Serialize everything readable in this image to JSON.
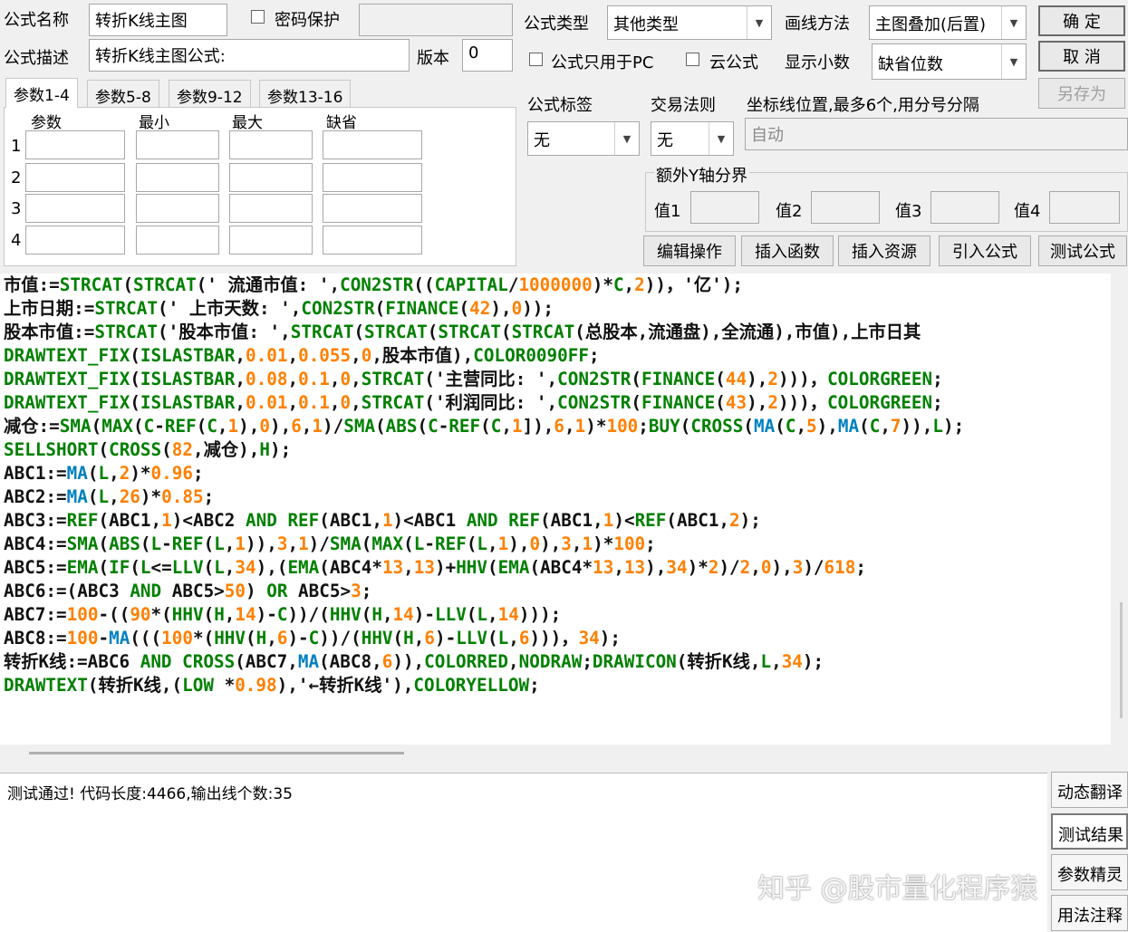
{
  "form": {
    "name_label": "公式名称",
    "name_value": "转折K线主图",
    "password_label": "密码保护",
    "desc_label": "公式描述",
    "desc_value": "转折K线主图公式:",
    "version_label": "版本",
    "version_value": "0",
    "type_label": "公式类型",
    "type_value": "其他类型",
    "draw_label": "画线方法",
    "draw_value": "主图叠加(后置)",
    "pc_only_label": "公式只用于PC",
    "cloud_label": "云公式",
    "decimal_label": "显示小数",
    "decimal_value": "缺省位数",
    "tag_label": "公式标签",
    "tag_value": "无",
    "trade_label": "交易法则",
    "trade_value": "无",
    "axis_label": "坐标线位置,最多6个,用分号分隔",
    "axis_value": "自动",
    "extra_y_label": "额外Y轴分界",
    "val1": "值1",
    "val2": "值2",
    "val3": "值3",
    "val4": "值4"
  },
  "buttons": {
    "ok": "确  定",
    "cancel": "取  消",
    "save_as": "另存为",
    "edit": "编辑操作",
    "insert_func": "插入函数",
    "insert_res": "插入资源",
    "import": "引入公式",
    "test": "测试公式"
  },
  "tabs": [
    "参数1-4",
    "参数5-8",
    "参数9-12",
    "参数13-16"
  ],
  "param_headers": [
    "参数",
    "最小",
    "最大",
    "缺省"
  ],
  "param_rows": [
    "1",
    "2",
    "3",
    "4"
  ],
  "output_text": "测试通过! 代码长度:4466,输出线个数:35",
  "side_buttons": [
    "动态翻译",
    "测试结果",
    "参数精灵",
    "用法注释"
  ],
  "watermark": "知乎 @股市量化程序猿",
  "code_lines": [
    [
      [
        "d",
        "市值:="
      ],
      [
        "k",
        "STRCAT"
      ],
      [
        "d",
        "("
      ],
      [
        "k",
        "STRCAT"
      ],
      [
        "d",
        "(' 流通市值: ',"
      ],
      [
        "k",
        "CON2STR"
      ],
      [
        "d",
        "(("
      ],
      [
        "k",
        "CAPITAL"
      ],
      [
        "d",
        "/"
      ],
      [
        "n",
        "1000000"
      ],
      [
        "d",
        ")*"
      ],
      [
        "k",
        "C"
      ],
      [
        "d",
        ","
      ],
      [
        "n",
        "2"
      ],
      [
        "d",
        "))，'亿');"
      ]
    ],
    [
      [
        "d",
        "上市日期:="
      ],
      [
        "k",
        "STRCAT"
      ],
      [
        "d",
        "(' 上市天数: ',"
      ],
      [
        "k",
        "CON2STR"
      ],
      [
        "d",
        "("
      ],
      [
        "k",
        "FINANCE"
      ],
      [
        "d",
        "("
      ],
      [
        "n",
        "42"
      ],
      [
        "d",
        "),"
      ],
      [
        "n",
        "0"
      ],
      [
        "d",
        "));"
      ]
    ],
    [
      [
        "d",
        "股本市值:="
      ],
      [
        "k",
        "STRCAT"
      ],
      [
        "d",
        "('股本市值: ',"
      ],
      [
        "k",
        "STRCAT"
      ],
      [
        "d",
        "("
      ],
      [
        "k",
        "STRCAT"
      ],
      [
        "d",
        "("
      ],
      [
        "k",
        "STRCAT"
      ],
      [
        "d",
        "("
      ],
      [
        "k",
        "STRCAT"
      ],
      [
        "d",
        "(总股本,流通盘),全流通),市值),上市日其"
      ]
    ],
    [
      [
        "k",
        "DRAWTEXT_FIX"
      ],
      [
        "d",
        "("
      ],
      [
        "k",
        "ISLASTBAR"
      ],
      [
        "d",
        ","
      ],
      [
        "n",
        "0.01"
      ],
      [
        "d",
        ","
      ],
      [
        "n",
        "0.055"
      ],
      [
        "d",
        ","
      ],
      [
        "n",
        "0"
      ],
      [
        "d",
        ",股本市值),"
      ],
      [
        "k",
        "COLOR0090FF"
      ],
      [
        "d",
        ";"
      ]
    ],
    [
      [
        "k",
        "DRAWTEXT_FIX"
      ],
      [
        "d",
        "("
      ],
      [
        "k",
        "ISLASTBAR"
      ],
      [
        "d",
        ","
      ],
      [
        "n",
        "0.08"
      ],
      [
        "d",
        ","
      ],
      [
        "n",
        "0.1"
      ],
      [
        "d",
        ","
      ],
      [
        "n",
        "0"
      ],
      [
        "d",
        ","
      ],
      [
        "k",
        "STRCAT"
      ],
      [
        "d",
        "('主营同比: ',"
      ],
      [
        "k",
        "CON2STR"
      ],
      [
        "d",
        "("
      ],
      [
        "k",
        "FINANCE"
      ],
      [
        "d",
        "("
      ],
      [
        "n",
        "44"
      ],
      [
        "d",
        "),"
      ],
      [
        "n",
        "2"
      ],
      [
        "d",
        ")))，"
      ],
      [
        "k",
        "COLORGREEN"
      ],
      [
        "d",
        ";"
      ]
    ],
    [
      [
        "k",
        "DRAWTEXT_FIX"
      ],
      [
        "d",
        "("
      ],
      [
        "k",
        "ISLASTBAR"
      ],
      [
        "d",
        ","
      ],
      [
        "n",
        "0.01"
      ],
      [
        "d",
        ","
      ],
      [
        "n",
        "0.1"
      ],
      [
        "d",
        ","
      ],
      [
        "n",
        "0"
      ],
      [
        "d",
        ","
      ],
      [
        "k",
        "STRCAT"
      ],
      [
        "d",
        "('利润同比: ',"
      ],
      [
        "k",
        "CON2STR"
      ],
      [
        "d",
        "("
      ],
      [
        "k",
        "FINANCE"
      ],
      [
        "d",
        "("
      ],
      [
        "n",
        "43"
      ],
      [
        "d",
        "),"
      ],
      [
        "n",
        "2"
      ],
      [
        "d",
        ")))，"
      ],
      [
        "k",
        "COLORGREEN"
      ],
      [
        "d",
        ";"
      ]
    ],
    [
      [
        "d",
        "减仓:="
      ],
      [
        "k",
        "SMA"
      ],
      [
        "d",
        "("
      ],
      [
        "k",
        "MAX"
      ],
      [
        "d",
        "("
      ],
      [
        "k",
        "C"
      ],
      [
        "d",
        "-"
      ],
      [
        "k",
        "REF"
      ],
      [
        "d",
        "("
      ],
      [
        "k",
        "C"
      ],
      [
        "d",
        ","
      ],
      [
        "n",
        "1"
      ],
      [
        "d",
        "),"
      ],
      [
        "n",
        "0"
      ],
      [
        "d",
        "),"
      ],
      [
        "n",
        "6"
      ],
      [
        "d",
        ","
      ],
      [
        "n",
        "1"
      ],
      [
        "d",
        ")/"
      ],
      [
        "k",
        "SMA"
      ],
      [
        "d",
        "("
      ],
      [
        "k",
        "ABS"
      ],
      [
        "d",
        "("
      ],
      [
        "k",
        "C"
      ],
      [
        "d",
        "-"
      ],
      [
        "k",
        "REF"
      ],
      [
        "d",
        "("
      ],
      [
        "k",
        "C"
      ],
      [
        "d",
        ","
      ],
      [
        "n",
        "1"
      ],
      [
        "d",
        "]),"
      ],
      [
        "n",
        "6"
      ],
      [
        "d",
        ","
      ],
      [
        "n",
        "1"
      ],
      [
        "d",
        ")*"
      ],
      [
        "n",
        "100"
      ],
      [
        "d",
        ";"
      ],
      [
        "k",
        "BUY"
      ],
      [
        "d",
        "("
      ],
      [
        "k",
        "CROSS"
      ],
      [
        "d",
        "("
      ],
      [
        "f",
        "MA"
      ],
      [
        "d",
        "("
      ],
      [
        "k",
        "C"
      ],
      [
        "d",
        ","
      ],
      [
        "n",
        "5"
      ],
      [
        "d",
        "),"
      ],
      [
        "f",
        "MA"
      ],
      [
        "d",
        "("
      ],
      [
        "k",
        "C"
      ],
      [
        "d",
        ","
      ],
      [
        "n",
        "7"
      ],
      [
        "d",
        ")),"
      ],
      [
        "k",
        "L"
      ],
      [
        "d",
        ");"
      ]
    ],
    [
      [
        "k",
        "SELLSHORT"
      ],
      [
        "d",
        "("
      ],
      [
        "k",
        "CROSS"
      ],
      [
        "d",
        "("
      ],
      [
        "n",
        "82"
      ],
      [
        "d",
        ",减仓),"
      ],
      [
        "k",
        "H"
      ],
      [
        "d",
        ");"
      ]
    ],
    [
      [
        "d",
        "ABC1:="
      ],
      [
        "f",
        "MA"
      ],
      [
        "d",
        "("
      ],
      [
        "k",
        "L"
      ],
      [
        "d",
        ","
      ],
      [
        "n",
        "2"
      ],
      [
        "d",
        ")*"
      ],
      [
        "n",
        "0.96"
      ],
      [
        "d",
        ";"
      ]
    ],
    [
      [
        "d",
        "ABC2:="
      ],
      [
        "f",
        "MA"
      ],
      [
        "d",
        "("
      ],
      [
        "k",
        "L"
      ],
      [
        "d",
        ","
      ],
      [
        "n",
        "26"
      ],
      [
        "d",
        ")*"
      ],
      [
        "n",
        "0.85"
      ],
      [
        "d",
        ";"
      ]
    ],
    [
      [
        "d",
        "ABC3:="
      ],
      [
        "k",
        "REF"
      ],
      [
        "d",
        "(ABC1,"
      ],
      [
        "n",
        "1"
      ],
      [
        "d",
        ")<ABC2 "
      ],
      [
        "k",
        "AND"
      ],
      [
        "d",
        " "
      ],
      [
        "k",
        "REF"
      ],
      [
        "d",
        "(ABC1,"
      ],
      [
        "n",
        "1"
      ],
      [
        "d",
        ")<ABC1 "
      ],
      [
        "k",
        "AND"
      ],
      [
        "d",
        " "
      ],
      [
        "k",
        "REF"
      ],
      [
        "d",
        "(ABC1,"
      ],
      [
        "n",
        "1"
      ],
      [
        "d",
        ")<"
      ],
      [
        "k",
        "REF"
      ],
      [
        "d",
        "(ABC1,"
      ],
      [
        "n",
        "2"
      ],
      [
        "d",
        ");"
      ]
    ],
    [
      [
        "d",
        "ABC4:="
      ],
      [
        "k",
        "SMA"
      ],
      [
        "d",
        "("
      ],
      [
        "k",
        "ABS"
      ],
      [
        "d",
        "("
      ],
      [
        "k",
        "L"
      ],
      [
        "d",
        "-"
      ],
      [
        "k",
        "REF"
      ],
      [
        "d",
        "("
      ],
      [
        "k",
        "L"
      ],
      [
        "d",
        ","
      ],
      [
        "n",
        "1"
      ],
      [
        "d",
        ")),"
      ],
      [
        "n",
        "3"
      ],
      [
        "d",
        ","
      ],
      [
        "n",
        "1"
      ],
      [
        "d",
        ")/"
      ],
      [
        "k",
        "SMA"
      ],
      [
        "d",
        "("
      ],
      [
        "k",
        "MAX"
      ],
      [
        "d",
        "("
      ],
      [
        "k",
        "L"
      ],
      [
        "d",
        "-"
      ],
      [
        "k",
        "REF"
      ],
      [
        "d",
        "("
      ],
      [
        "k",
        "L"
      ],
      [
        "d",
        ","
      ],
      [
        "n",
        "1"
      ],
      [
        "d",
        "),"
      ],
      [
        "n",
        "0"
      ],
      [
        "d",
        "),"
      ],
      [
        "n",
        "3"
      ],
      [
        "d",
        ","
      ],
      [
        "n",
        "1"
      ],
      [
        "d",
        ")*"
      ],
      [
        "n",
        "100"
      ],
      [
        "d",
        ";"
      ]
    ],
    [
      [
        "d",
        "ABC5:="
      ],
      [
        "k",
        "EMA"
      ],
      [
        "d",
        "("
      ],
      [
        "k",
        "IF"
      ],
      [
        "d",
        "("
      ],
      [
        "k",
        "L"
      ],
      [
        "d",
        "<="
      ],
      [
        "k",
        "LLV"
      ],
      [
        "d",
        "("
      ],
      [
        "k",
        "L"
      ],
      [
        "d",
        ","
      ],
      [
        "n",
        "34"
      ],
      [
        "d",
        "),("
      ],
      [
        "k",
        "EMA"
      ],
      [
        "d",
        "(ABC4*"
      ],
      [
        "n",
        "13"
      ],
      [
        "d",
        ","
      ],
      [
        "n",
        "13"
      ],
      [
        "d",
        ")+"
      ],
      [
        "k",
        "HHV"
      ],
      [
        "d",
        "("
      ],
      [
        "k",
        "EMA"
      ],
      [
        "d",
        "(ABC4*"
      ],
      [
        "n",
        "13"
      ],
      [
        "d",
        ","
      ],
      [
        "n",
        "13"
      ],
      [
        "d",
        "),"
      ],
      [
        "n",
        "34"
      ],
      [
        "d",
        ")*"
      ],
      [
        "n",
        "2"
      ],
      [
        "d",
        ")/"
      ],
      [
        "n",
        "2"
      ],
      [
        "d",
        ","
      ],
      [
        "n",
        "0"
      ],
      [
        "d",
        "),"
      ],
      [
        "n",
        "3"
      ],
      [
        "d",
        ")/"
      ],
      [
        "n",
        "618"
      ],
      [
        "d",
        ";"
      ]
    ],
    [
      [
        "d",
        "ABC6:=(ABC3 "
      ],
      [
        "k",
        "AND"
      ],
      [
        "d",
        " ABC5>"
      ],
      [
        "n",
        "50"
      ],
      [
        "d",
        ") "
      ],
      [
        "k",
        "OR"
      ],
      [
        "d",
        " ABC5>"
      ],
      [
        "n",
        "3"
      ],
      [
        "d",
        ";"
      ]
    ],
    [
      [
        "d",
        "ABC7:="
      ],
      [
        "n",
        "100"
      ],
      [
        "d",
        "-(("
      ],
      [
        "n",
        "90"
      ],
      [
        "d",
        "*("
      ],
      [
        "k",
        "HHV"
      ],
      [
        "d",
        "("
      ],
      [
        "k",
        "H"
      ],
      [
        "d",
        ","
      ],
      [
        "n",
        "14"
      ],
      [
        "d",
        ")-"
      ],
      [
        "k",
        "C"
      ],
      [
        "d",
        "))/("
      ],
      [
        "k",
        "HHV"
      ],
      [
        "d",
        "("
      ],
      [
        "k",
        "H"
      ],
      [
        "d",
        ","
      ],
      [
        "n",
        "14"
      ],
      [
        "d",
        ")-"
      ],
      [
        "k",
        "LLV"
      ],
      [
        "d",
        "("
      ],
      [
        "k",
        "L"
      ],
      [
        "d",
        ","
      ],
      [
        "n",
        "14"
      ],
      [
        "d",
        ")));"
      ]
    ],
    [
      [
        "d",
        "ABC8:="
      ],
      [
        "n",
        "100"
      ],
      [
        "d",
        "-"
      ],
      [
        "f",
        "MA"
      ],
      [
        "d",
        "((("
      ],
      [
        "n",
        "100"
      ],
      [
        "d",
        "*("
      ],
      [
        "k",
        "HHV"
      ],
      [
        "d",
        "("
      ],
      [
        "k",
        "H"
      ],
      [
        "d",
        ","
      ],
      [
        "n",
        "6"
      ],
      [
        "d",
        ")-"
      ],
      [
        "k",
        "C"
      ],
      [
        "d",
        "))/("
      ],
      [
        "k",
        "HHV"
      ],
      [
        "d",
        "("
      ],
      [
        "k",
        "H"
      ],
      [
        "d",
        ","
      ],
      [
        "n",
        "6"
      ],
      [
        "d",
        ")-"
      ],
      [
        "k",
        "LLV"
      ],
      [
        "d",
        "("
      ],
      [
        "k",
        "L"
      ],
      [
        "d",
        ","
      ],
      [
        "n",
        "6"
      ],
      [
        "d",
        ")))，"
      ],
      [
        "n",
        "34"
      ],
      [
        "d",
        ");"
      ]
    ],
    [
      [
        "d",
        "转折K线:=ABC6 "
      ],
      [
        "k",
        "AND"
      ],
      [
        "d",
        " "
      ],
      [
        "k",
        "CROSS"
      ],
      [
        "d",
        "(ABC7,"
      ],
      [
        "f",
        "MA"
      ],
      [
        "d",
        "(ABC8,"
      ],
      [
        "n",
        "6"
      ],
      [
        "d",
        ")),"
      ],
      [
        "k",
        "COLORRED"
      ],
      [
        "d",
        ","
      ],
      [
        "k",
        "NODRAW"
      ],
      [
        "d",
        ";"
      ],
      [
        "k",
        "DRAWICON"
      ],
      [
        "d",
        "(转折K线,"
      ],
      [
        "k",
        "L"
      ],
      [
        "d",
        ","
      ],
      [
        "n",
        "34"
      ],
      [
        "d",
        ");"
      ]
    ],
    [
      [
        "k",
        "DRAWTEXT"
      ],
      [
        "d",
        "(转折K线,("
      ],
      [
        "k",
        "LOW"
      ],
      [
        "d",
        " *"
      ],
      [
        "n",
        "0.98"
      ],
      [
        "d",
        "),'←转折K线'),"
      ],
      [
        "k",
        "COLORYELLOW"
      ],
      [
        "d",
        ";"
      ]
    ]
  ]
}
